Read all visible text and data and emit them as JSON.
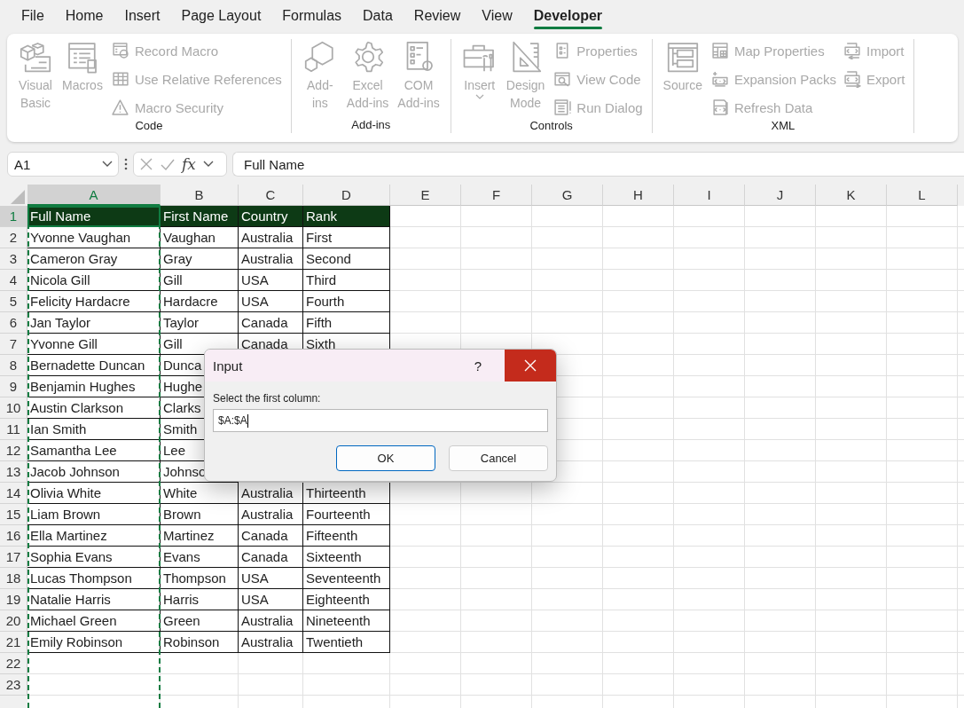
{
  "ribbon": {
    "tabs": [
      {
        "label": "File",
        "selected": false
      },
      {
        "label": "Home",
        "selected": false
      },
      {
        "label": "Insert",
        "selected": false
      },
      {
        "label": "Page Layout",
        "selected": false
      },
      {
        "label": "Formulas",
        "selected": false
      },
      {
        "label": "Data",
        "selected": false
      },
      {
        "label": "Review",
        "selected": false
      },
      {
        "label": "View",
        "selected": false
      },
      {
        "label": "Developer",
        "selected": true
      }
    ],
    "groups": [
      {
        "label": "Code",
        "items": [
          {
            "kind": "large",
            "lines": [
              "Visual",
              "Basic"
            ],
            "disabled": true
          },
          {
            "kind": "large",
            "lines": [
              "Macros"
            ],
            "disabled": true
          },
          {
            "kind": "small",
            "label": "Record Macro",
            "disabled": true
          },
          {
            "kind": "small",
            "label": "Use Relative References",
            "disabled": true
          },
          {
            "kind": "small",
            "label": "Macro Security",
            "disabled": true
          }
        ]
      },
      {
        "label": "Add-ins",
        "items": [
          {
            "kind": "large",
            "lines": [
              "Add-",
              "ins"
            ],
            "disabled": true
          },
          {
            "kind": "large",
            "lines": [
              "Excel",
              "Add-ins"
            ],
            "disabled": true
          },
          {
            "kind": "large",
            "lines": [
              "COM",
              "Add-ins"
            ],
            "disabled": true
          }
        ]
      },
      {
        "label": "Controls",
        "items": [
          {
            "kind": "large",
            "lines": [
              "Insert"
            ],
            "dropdown": true,
            "disabled": true
          },
          {
            "kind": "large",
            "lines": [
              "Design",
              "Mode"
            ],
            "disabled": true
          },
          {
            "kind": "small",
            "label": "Properties",
            "disabled": true
          },
          {
            "kind": "small",
            "label": "View Code",
            "disabled": true
          },
          {
            "kind": "small",
            "label": "Run Dialog",
            "disabled": true
          }
        ]
      },
      {
        "label": "XML",
        "items": [
          {
            "kind": "large",
            "lines": [
              "Source"
            ],
            "disabled": true
          },
          {
            "kind": "small",
            "label": "Map Properties",
            "disabled": true
          },
          {
            "kind": "small",
            "label": "Expansion Packs",
            "disabled": true
          },
          {
            "kind": "small",
            "label": "Refresh Data",
            "disabled": true
          },
          {
            "kind": "small",
            "label": "Import",
            "disabled": true
          },
          {
            "kind": "small",
            "label": "Export",
            "disabled": true
          }
        ]
      }
    ]
  },
  "formula_bar": {
    "name_box": "A1",
    "fx_symbol": "fx",
    "formula": "Full Name"
  },
  "sheet": {
    "columns": [
      {
        "label": "A",
        "selected": true
      },
      {
        "label": "B",
        "selected": false
      },
      {
        "label": "C",
        "selected": false
      },
      {
        "label": "D",
        "selected": false
      },
      {
        "label": "E",
        "selected": false
      },
      {
        "label": "F",
        "selected": false
      },
      {
        "label": "G",
        "selected": false
      },
      {
        "label": "H",
        "selected": false
      },
      {
        "label": "I",
        "selected": false
      },
      {
        "label": "J",
        "selected": false
      },
      {
        "label": "K",
        "selected": false
      },
      {
        "label": "L",
        "selected": false
      }
    ],
    "rows": [
      {
        "number": "1",
        "selected": true,
        "header": true,
        "cells": [
          "Full Name",
          "First Name",
          "Country",
          "Rank"
        ]
      },
      {
        "number": "2",
        "selected": false,
        "header": false,
        "cells": [
          "Yvonne Vaughan",
          "Vaughan",
          "Australia",
          "First"
        ]
      },
      {
        "number": "3",
        "selected": false,
        "header": false,
        "cells": [
          "Cameron Gray",
          "Gray",
          "Australia",
          "Second"
        ]
      },
      {
        "number": "4",
        "selected": false,
        "header": false,
        "cells": [
          "Nicola Gill",
          "Gill",
          "USA",
          "Third"
        ]
      },
      {
        "number": "5",
        "selected": false,
        "header": false,
        "cells": [
          "Felicity Hardacre",
          "Hardacre",
          "USA",
          "Fourth"
        ]
      },
      {
        "number": "6",
        "selected": false,
        "header": false,
        "cells": [
          "Jan Taylor",
          "Taylor",
          "Canada",
          "Fifth"
        ]
      },
      {
        "number": "7",
        "selected": false,
        "header": false,
        "cells": [
          "Yvonne Gill",
          "Gill",
          "Canada",
          "Sixth"
        ]
      },
      {
        "number": "8",
        "selected": false,
        "header": false,
        "cells": [
          "Bernadette Duncan",
          "Dunca"
        ]
      },
      {
        "number": "9",
        "selected": false,
        "header": false,
        "cells": [
          "Benjamin Hughes",
          "Hughe"
        ]
      },
      {
        "number": "10",
        "selected": false,
        "header": false,
        "cells": [
          "Austin Clarkson",
          "Clarks"
        ]
      },
      {
        "number": "11",
        "selected": false,
        "header": false,
        "cells": [
          "Ian Smith",
          "Smith"
        ]
      },
      {
        "number": "12",
        "selected": false,
        "header": false,
        "cells": [
          "Samantha Lee",
          "Lee"
        ]
      },
      {
        "number": "13",
        "selected": false,
        "header": false,
        "cells": [
          "Jacob Johnson",
          "Johnso"
        ]
      },
      {
        "number": "14",
        "selected": false,
        "header": false,
        "cells": [
          "Olivia White",
          "White",
          "Australia",
          "Thirteenth"
        ]
      },
      {
        "number": "15",
        "selected": false,
        "header": false,
        "cells": [
          "Liam Brown",
          "Brown",
          "Australia",
          "Fourteenth"
        ]
      },
      {
        "number": "16",
        "selected": false,
        "header": false,
        "cells": [
          "Ella Martinez",
          "Martinez",
          "Canada",
          "Fifteenth"
        ]
      },
      {
        "number": "17",
        "selected": false,
        "header": false,
        "cells": [
          "Sophia Evans",
          "Evans",
          "Canada",
          "Sixteenth"
        ]
      },
      {
        "number": "18",
        "selected": false,
        "header": false,
        "cells": [
          "Lucas Thompson",
          "Thompson",
          "USA",
          "Seventeenth"
        ]
      },
      {
        "number": "19",
        "selected": false,
        "header": false,
        "cells": [
          "Natalie Harris",
          "Harris",
          "USA",
          "Eighteenth"
        ]
      },
      {
        "number": "20",
        "selected": false,
        "header": false,
        "cells": [
          "Michael Green",
          "Green",
          "Australia",
          "Nineteenth"
        ]
      },
      {
        "number": "21",
        "selected": false,
        "header": false,
        "cells": [
          "Emily Robinson",
          "Robinson",
          "Australia",
          "Twentieth"
        ]
      },
      {
        "number": "22",
        "selected": false
      },
      {
        "number": "23",
        "selected": false
      }
    ]
  },
  "dialog": {
    "title": "Input",
    "help": "?",
    "prompt": "Select the first column:",
    "value": "$A:$A",
    "buttons": [
      {
        "label": "OK",
        "default": true
      },
      {
        "label": "Cancel",
        "default": false
      }
    ]
  }
}
